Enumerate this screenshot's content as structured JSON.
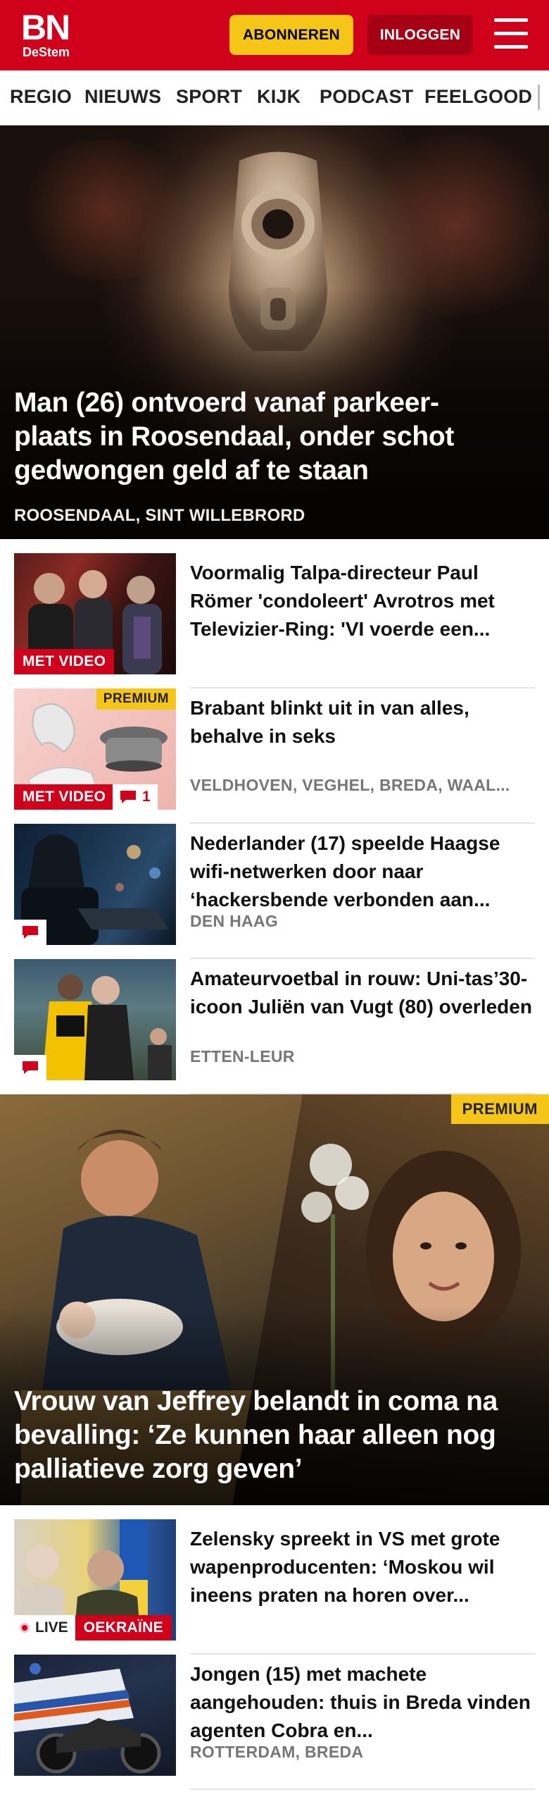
{
  "header": {
    "logo_main": "BN",
    "logo_sub": "DeStem",
    "subscribe_label": "ABONNEREN",
    "login_label": "INLOGGEN"
  },
  "nav": {
    "items": [
      "REGIO",
      "NIEUWS",
      "SPORT",
      "KIJK",
      "PODCAST",
      "FEELGOOD"
    ]
  },
  "hero": {
    "title": "Man (26) ontvoerd vanaf parkeer-plaats in Roosendaal, onder schot gedwongen geld af te staan",
    "location": "ROOSENDAAL, SINT WILLEBRORD"
  },
  "articles": [
    {
      "title": "Voormalig Talpa-directeur Paul Römer 'condoleert' Avrotros met Televizier-Ring: 'VI voerde een...",
      "location": "",
      "video_label": "MET VIDEO"
    },
    {
      "title": "Brabant blinkt uit in van alles, behalve in seks",
      "location": "VELDHOVEN, VEGHEL, BREDA, WAAL...",
      "video_label": "MET VIDEO",
      "comments": "1",
      "premium_label": "PREMIUM"
    },
    {
      "title": "Nederlander (17) speelde Haagse wifi-netwerken door naar ‘hackersbende verbonden aan...",
      "location": "DEN HAAG"
    },
    {
      "title": "Amateurvoetbal in rouw: Uni-tas’30-icoon Juliën van Vugt (80) overleden",
      "location": "ETTEN-LEUR"
    }
  ],
  "feature": {
    "title": "Vrouw van Jeffrey belandt in coma na bevalling: ‘Ze kunnen haar alleen nog palliatieve zorg geven’",
    "premium_label": "PREMIUM"
  },
  "articles2": [
    {
      "title": "Zelensky spreekt in VS met grote wapenproducenten: ‘Moskou wil ineens praten na horen over...",
      "live_label": "LIVE",
      "topic_label": "OEKRAÏNE"
    },
    {
      "title": "Jongen (15) met machete aangehouden: thuis in Breda vinden agenten Cobra en...",
      "location": "ROTTERDAM, BREDA"
    }
  ],
  "colors": {
    "brand_red": "#d0021b",
    "subscribe_yellow": "#f5c518",
    "login_dark_red": "#a50014",
    "location_grey": "#767676"
  }
}
